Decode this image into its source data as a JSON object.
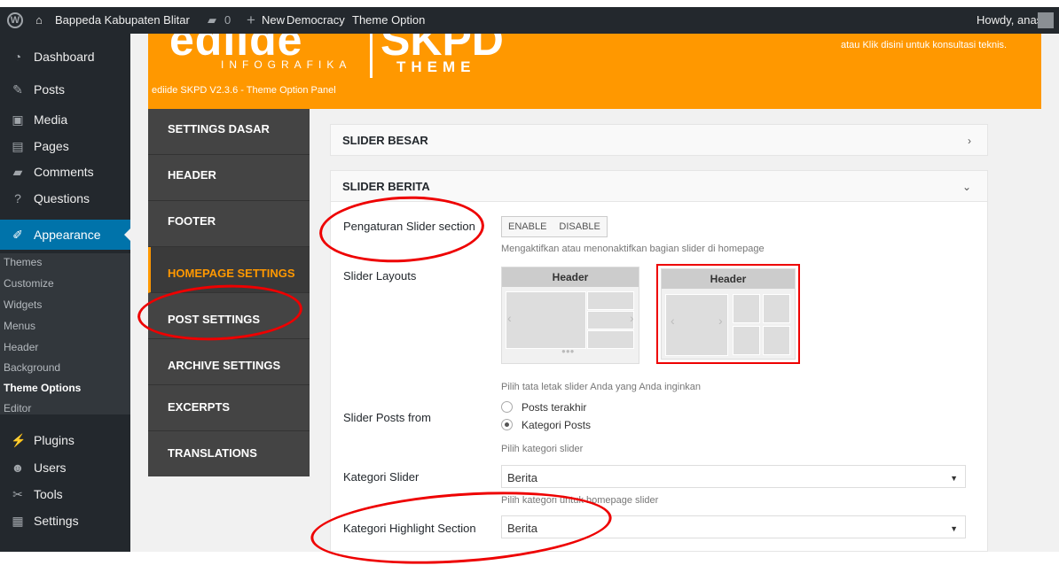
{
  "admin_bar": {
    "site_name": "Bappeda Kabupaten Blitar",
    "comments_count": "0",
    "new_label": "New",
    "link1": "Democracy",
    "link2": "Theme Option",
    "greeting": "Howdy, anas"
  },
  "sidebar": {
    "items": [
      {
        "label": "Dashboard",
        "icon": "dashboard-icon"
      },
      {
        "label": "Posts",
        "icon": "pin-icon"
      },
      {
        "label": "Media",
        "icon": "media-icon"
      },
      {
        "label": "Pages",
        "icon": "pages-icon"
      },
      {
        "label": "Comments",
        "icon": "comment-icon"
      },
      {
        "label": "Questions",
        "icon": "question-icon"
      },
      {
        "label": "Appearance",
        "icon": "brush-icon"
      },
      {
        "label": "Plugins",
        "icon": "plugin-icon"
      },
      {
        "label": "Users",
        "icon": "users-icon"
      },
      {
        "label": "Tools",
        "icon": "wrench-icon"
      },
      {
        "label": "Settings",
        "icon": "settings-icon"
      }
    ],
    "submenu": [
      "Themes",
      "Customize",
      "Widgets",
      "Menus",
      "Header",
      "Background",
      "Theme Options",
      "Editor"
    ]
  },
  "banner": {
    "logo_main": "ediide",
    "logo_sub": "INFOGRAFIKA",
    "logo_right": "SKPD",
    "logo_theme": "THEME",
    "version": "ediide SKPD V2.3.6 - Theme Option Panel",
    "consult": "atau Klik disini untuk konsultasi teknis."
  },
  "tabs": [
    "SETTINGS DASAR",
    "HEADER",
    "FOOTER",
    "HOMEPAGE SETTINGS",
    "POST SETTINGS",
    "ARCHIVE SETTINGS",
    "EXCERPTS",
    "TRANSLATIONS"
  ],
  "sections": {
    "slider_besar": "SLIDER BESAR",
    "slider_berita": "SLIDER BERITA"
  },
  "form": {
    "pengaturan_label": "Pengaturan Slider section",
    "enable": "ENABLE",
    "disable": "DISABLE",
    "pengaturan_desc": "Mengaktifkan atau menonaktifkan bagian slider di homepage",
    "layouts_label": "Slider Layouts",
    "layout_header": "Header",
    "layouts_desc": "Pilih tata letak slider Anda yang Anda inginkan",
    "posts_from_label": "Slider Posts from",
    "radio1": "Posts terakhir",
    "radio2": "Kategori Posts",
    "posts_from_desc": "Pilih kategori slider",
    "kategori_label": "Kategori Slider",
    "kategori_value": "Berita",
    "kategori_desc": "Pilih kategori untuk homepage slider",
    "highlight_label": "Kategori Highlight Section",
    "highlight_value": "Berita"
  },
  "colors": {
    "accent": "#ff9800",
    "admin_blue": "#0073aa",
    "annotation": "#e00000"
  }
}
